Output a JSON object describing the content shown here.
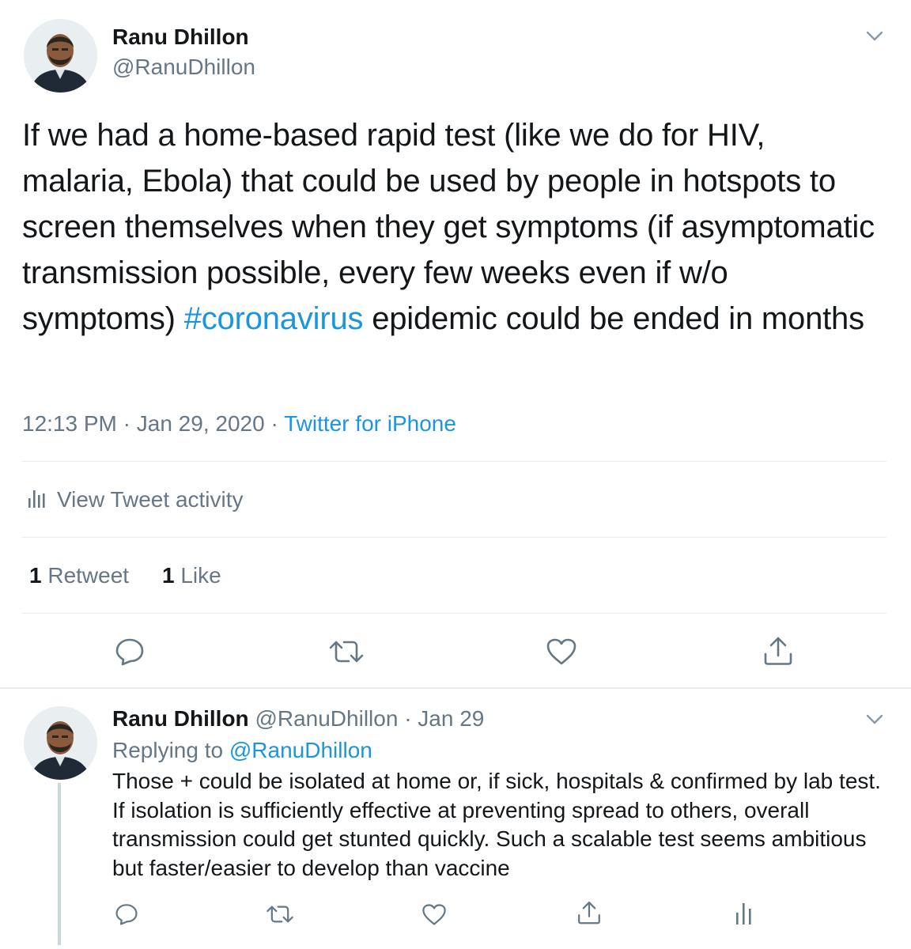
{
  "tweet": {
    "author_name": "Ranu Dhillon",
    "author_handle": "@RanuDhillon",
    "text_parts": [
      "If we had a home-based rapid test (like we do for HIV, malaria, Ebola) that could be used by people in hotspots to screen themselves when they get symptoms (if asymptomatic transmission possible, every few weeks even if w/o symptoms) ",
      "#coronavirus",
      " epidemic could be ended in months"
    ],
    "time": "12:13 PM",
    "date": "Jan 29, 2020",
    "separator": "·",
    "source": "Twitter for iPhone",
    "activity_label": "View Tweet activity",
    "retweet_count": "1",
    "retweet_label": "Retweet",
    "like_count": "1",
    "like_label": "Like"
  },
  "reply": {
    "author_name": "Ranu Dhillon",
    "author_handle": "@RanuDhillon",
    "separator": "·",
    "date": "Jan 29",
    "replying_prefix": "Replying to",
    "replying_handle": "@RanuDhillon",
    "text": "Those + could be isolated at home or, if sick, hospitals & confirmed by lab test. If isolation is sufficiently effective at preventing spread to others, overall transmission could get stunted quickly. Such a scalable test seems ambitious but faster/easier to develop than vaccine"
  },
  "icons": {
    "caret": "chevron-down-icon",
    "reply": "reply-icon",
    "retweet": "retweet-icon",
    "like": "heart-icon",
    "share": "share-icon",
    "analytics": "analytics-icon"
  },
  "colors": {
    "link": "#1b95e0",
    "text": "#14171a",
    "secondary": "#657786",
    "divider": "#e6ecf0"
  }
}
